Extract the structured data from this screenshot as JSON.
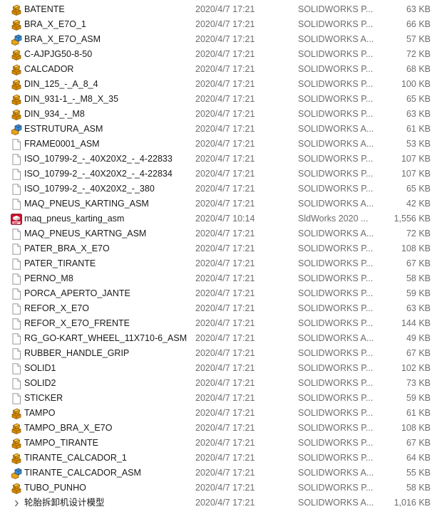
{
  "files": [
    {
      "name": "BATENTE",
      "date": "2020/4/7 17:21",
      "type": "SOLIDWORKS P...",
      "size": "63 KB",
      "icon": "solidworks-part-icon"
    },
    {
      "name": "BRA_X_E7O_1",
      "date": "2020/4/7 17:21",
      "type": "SOLIDWORKS P...",
      "size": "66 KB",
      "icon": "solidworks-part-icon"
    },
    {
      "name": "BRA_X_E7O_ASM",
      "date": "2020/4/7 17:21",
      "type": "SOLIDWORKS A...",
      "size": "57 KB",
      "icon": "solidworks-assembly-icon"
    },
    {
      "name": "C-AJPJG50-8-50",
      "date": "2020/4/7 17:21",
      "type": "SOLIDWORKS P...",
      "size": "72 KB",
      "icon": "solidworks-part-icon"
    },
    {
      "name": "CALCADOR",
      "date": "2020/4/7 17:21",
      "type": "SOLIDWORKS P...",
      "size": "68 KB",
      "icon": "solidworks-part-icon"
    },
    {
      "name": "DIN_125_-_A_8_4",
      "date": "2020/4/7 17:21",
      "type": "SOLIDWORKS P...",
      "size": "100 KB",
      "icon": "solidworks-part-icon"
    },
    {
      "name": "DIN_931-1_-_M8_X_35",
      "date": "2020/4/7 17:21",
      "type": "SOLIDWORKS P...",
      "size": "65 KB",
      "icon": "solidworks-part-icon"
    },
    {
      "name": "DIN_934_-_M8",
      "date": "2020/4/7 17:21",
      "type": "SOLIDWORKS P...",
      "size": "63 KB",
      "icon": "solidworks-part-icon"
    },
    {
      "name": "ESTRUTURA_ASM",
      "date": "2020/4/7 17:21",
      "type": "SOLIDWORKS A...",
      "size": "61 KB",
      "icon": "solidworks-assembly-icon"
    },
    {
      "name": "FRAME0001_ASM",
      "date": "2020/4/7 17:21",
      "type": "SOLIDWORKS A...",
      "size": "53 KB",
      "icon": "blank-file-icon"
    },
    {
      "name": "ISO_10799-2_-_40X20X2_-_4-22833",
      "date": "2020/4/7 17:21",
      "type": "SOLIDWORKS P...",
      "size": "107 KB",
      "icon": "blank-file-icon"
    },
    {
      "name": "ISO_10799-2_-_40X20X2_-_4-22834",
      "date": "2020/4/7 17:21",
      "type": "SOLIDWORKS P...",
      "size": "107 KB",
      "icon": "blank-file-icon"
    },
    {
      "name": "ISO_10799-2_-_40X20X2_-_380",
      "date": "2020/4/7 17:21",
      "type": "SOLIDWORKS P...",
      "size": "65 KB",
      "icon": "blank-file-icon"
    },
    {
      "name": "MAQ_PNEUS_KARTING_ASM",
      "date": "2020/4/7 17:21",
      "type": "SOLIDWORKS A...",
      "size": "42 KB",
      "icon": "blank-file-icon"
    },
    {
      "name": "maq_pneus_karting_asm",
      "date": "2020/4/7 10:14",
      "type": "SldWorks 2020 ...",
      "size": "1,556 KB",
      "icon": "sldworks-2020-icon"
    },
    {
      "name": "MAQ_PNEUS_KARTNG_ASM",
      "date": "2020/4/7 17:21",
      "type": "SOLIDWORKS A...",
      "size": "72 KB",
      "icon": "blank-file-icon"
    },
    {
      "name": "PATER_BRA_X_E7O",
      "date": "2020/4/7 17:21",
      "type": "SOLIDWORKS P...",
      "size": "108 KB",
      "icon": "blank-file-icon"
    },
    {
      "name": "PATER_TIRANTE",
      "date": "2020/4/7 17:21",
      "type": "SOLIDWORKS P...",
      "size": "67 KB",
      "icon": "blank-file-icon"
    },
    {
      "name": "PERNO_M8",
      "date": "2020/4/7 17:21",
      "type": "SOLIDWORKS P...",
      "size": "58 KB",
      "icon": "blank-file-icon"
    },
    {
      "name": "PORCA_APERTO_JANTE",
      "date": "2020/4/7 17:21",
      "type": "SOLIDWORKS P...",
      "size": "59 KB",
      "icon": "blank-file-icon"
    },
    {
      "name": "REFOR_X_E7O",
      "date": "2020/4/7 17:21",
      "type": "SOLIDWORKS P...",
      "size": "63 KB",
      "icon": "blank-file-icon"
    },
    {
      "name": "REFOR_X_E7O_FRENTE",
      "date": "2020/4/7 17:21",
      "type": "SOLIDWORKS P...",
      "size": "144 KB",
      "icon": "blank-file-icon"
    },
    {
      "name": "RG_GO-KART_WHEEL_11X710-6_ASM",
      "date": "2020/4/7 17:21",
      "type": "SOLIDWORKS A...",
      "size": "49 KB",
      "icon": "blank-file-icon"
    },
    {
      "name": "RUBBER_HANDLE_GRIP",
      "date": "2020/4/7 17:21",
      "type": "SOLIDWORKS P...",
      "size": "67 KB",
      "icon": "blank-file-icon"
    },
    {
      "name": "SOLID1",
      "date": "2020/4/7 17:21",
      "type": "SOLIDWORKS P...",
      "size": "102 KB",
      "icon": "blank-file-icon"
    },
    {
      "name": "SOLID2",
      "date": "2020/4/7 17:21",
      "type": "SOLIDWORKS P...",
      "size": "73 KB",
      "icon": "blank-file-icon"
    },
    {
      "name": "STICKER",
      "date": "2020/4/7 17:21",
      "type": "SOLIDWORKS P...",
      "size": "59 KB",
      "icon": "blank-file-icon"
    },
    {
      "name": "TAMPO",
      "date": "2020/4/7 17:21",
      "type": "SOLIDWORKS P...",
      "size": "61 KB",
      "icon": "solidworks-part-icon"
    },
    {
      "name": "TAMPO_BRA_X_E7O",
      "date": "2020/4/7 17:21",
      "type": "SOLIDWORKS P...",
      "size": "108 KB",
      "icon": "solidworks-part-icon"
    },
    {
      "name": "TAMPO_TIRANTE",
      "date": "2020/4/7 17:21",
      "type": "SOLIDWORKS P...",
      "size": "67 KB",
      "icon": "solidworks-part-icon"
    },
    {
      "name": "TIRANTE_CALCADOR_1",
      "date": "2020/4/7 17:21",
      "type": "SOLIDWORKS P...",
      "size": "64 KB",
      "icon": "solidworks-part-icon"
    },
    {
      "name": "TIRANTE_CALCADOR_ASM",
      "date": "2020/4/7 17:21",
      "type": "SOLIDWORKS A...",
      "size": "55 KB",
      "icon": "solidworks-assembly-icon"
    },
    {
      "name": "TUBO_PUNHO",
      "date": "2020/4/7 17:21",
      "type": "SOLIDWORKS P...",
      "size": "58 KB",
      "icon": "solidworks-part-icon"
    },
    {
      "name": "轮胎拆卸机设计模型",
      "date": "2020/4/7 17:21",
      "type": "SOLIDWORKS A...",
      "size": "1,016 KB",
      "icon": "shortcut-arrow-icon"
    }
  ],
  "colors": {
    "part_icon": "#e8a317",
    "assembly_icon": "#3d8fd6",
    "sldworks_icon": "#c8102e",
    "secondary_text": "#6d6d6d"
  }
}
